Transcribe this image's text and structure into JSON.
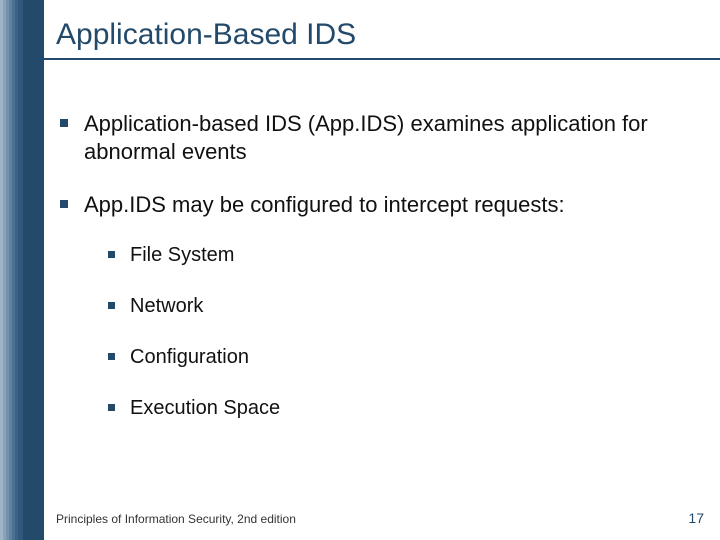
{
  "colors": {
    "accent": "#234a6a",
    "sidebar_bars": [
      "#9fb4c6",
      "#8aa3b9",
      "#7592ac",
      "#60829f",
      "#4c7192",
      "#3b6386",
      "#2f587c",
      "#234a6a",
      "#234a6a",
      "#234a6a"
    ]
  },
  "slide": {
    "title": "Application-Based IDS",
    "bullets": [
      {
        "text": "Application-based IDS (App.IDS) examines application for abnormal events"
      },
      {
        "text": "App.IDS may be configured to intercept requests:",
        "children": [
          {
            "text": "File System"
          },
          {
            "text": "Network"
          },
          {
            "text": "Configuration"
          },
          {
            "text": "Execution Space"
          }
        ]
      }
    ]
  },
  "footer": {
    "left": "Principles of Information Security, 2nd edition",
    "page": "17"
  }
}
